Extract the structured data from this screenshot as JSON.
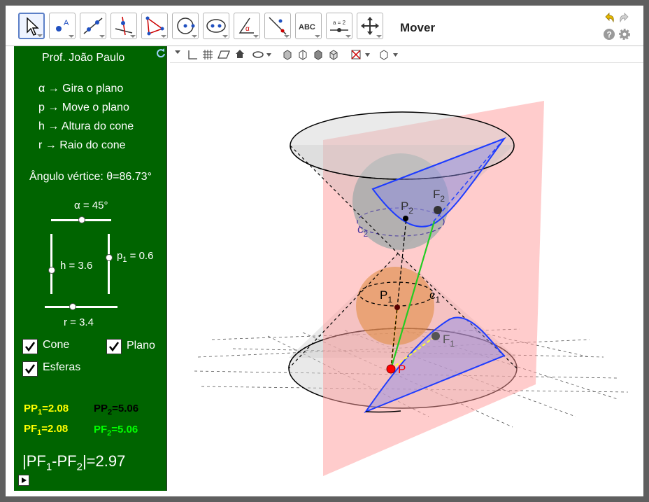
{
  "toolbar": {
    "mode_label": "Mover",
    "tools": [
      {
        "name": "move-tool",
        "icon": "arrow-cursor-icon"
      },
      {
        "name": "point-tool",
        "icon": "point-icon",
        "letter": "A"
      },
      {
        "name": "line-tool",
        "icon": "line-icon"
      },
      {
        "name": "perpendicular-tool",
        "icon": "perpendicular-icon"
      },
      {
        "name": "polygon-tool",
        "icon": "polygon-icon"
      },
      {
        "name": "circle-tool",
        "icon": "circle-icon"
      },
      {
        "name": "conic-tool",
        "icon": "ellipse-icon"
      },
      {
        "name": "angle-tool",
        "icon": "angle-icon",
        "letter": "α"
      },
      {
        "name": "reflect-tool",
        "icon": "reflect-icon"
      },
      {
        "name": "text-tool",
        "icon": "text-icon",
        "letter": "ABC"
      },
      {
        "name": "slider-tool",
        "icon": "slider-icon",
        "letter": "a = 2"
      },
      {
        "name": "move-view-tool",
        "icon": "move-graphics-icon"
      }
    ]
  },
  "panel": {
    "author": "Prof. João Paulo",
    "legend": [
      "α → Gira o plano",
      "p → Move o plano",
      "h → Altura do cone",
      "r → Raio do cone"
    ],
    "angle_text": "Ângulo vértice: θ=86.73°",
    "sliders": {
      "alpha": {
        "label": "α = 45°",
        "value": 45
      },
      "h": {
        "label": "h = 3.6",
        "value": 3.6
      },
      "p1": {
        "label_main": "p",
        "label_sub": "1",
        "label_rest": " = 0.6",
        "value": 0.6
      },
      "r": {
        "label": "r = 3.4",
        "value": 3.4
      }
    },
    "checkboxes": {
      "cone": {
        "label": "Cone",
        "checked": true
      },
      "plano": {
        "label": "Plano",
        "checked": true
      },
      "esferas": {
        "label": "Esferas",
        "checked": true
      }
    },
    "measures": {
      "pp1_a": {
        "pre": "PP",
        "sub": "1",
        "post": "=2.08"
      },
      "pp2": {
        "pre": "PP",
        "sub": "2",
        "post": "=5.06"
      },
      "pf1": {
        "pre": "PF",
        "sub": "1",
        "post": "=2.08"
      },
      "pf2": {
        "pre": "PF",
        "sub": "2",
        "post": "=5.06"
      }
    },
    "difference": {
      "p1": "|PF",
      "s1": "1",
      "p2": "-PF",
      "s2": "2",
      "p3": "|=2.97"
    }
  },
  "view": {
    "labels": {
      "P2": {
        "main": "P",
        "sub": "2"
      },
      "F2": {
        "main": "F",
        "sub": "2"
      },
      "c2": {
        "main": "c",
        "sub": "2"
      },
      "P1": {
        "main": "P",
        "sub": "1"
      },
      "c1": {
        "main": "c",
        "sub": "1"
      },
      "F1": {
        "main": "F",
        "sub": "1"
      },
      "P": "P"
    }
  },
  "colors": {
    "panel_bg": "#006400",
    "yellow": "#ffff00",
    "green": "#00ff00",
    "plane": "#ff9a9a",
    "cone_blue": "#1e3cff"
  }
}
